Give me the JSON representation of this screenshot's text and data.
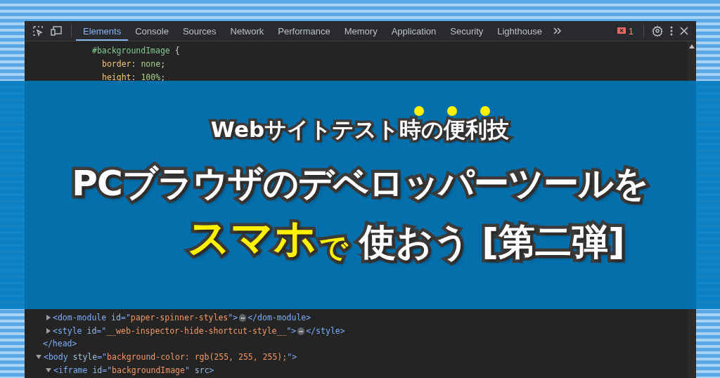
{
  "toolbar": {
    "tabs": [
      {
        "label": "Elements",
        "selected": true
      },
      {
        "label": "Console",
        "selected": false
      },
      {
        "label": "Sources",
        "selected": false
      },
      {
        "label": "Network",
        "selected": false
      },
      {
        "label": "Performance",
        "selected": false
      },
      {
        "label": "Memory",
        "selected": false
      },
      {
        "label": "Application",
        "selected": false
      },
      {
        "label": "Security",
        "selected": false
      },
      {
        "label": "Lighthouse",
        "selected": false
      }
    ],
    "error_count": "1"
  },
  "css_rule": {
    "selector": "#backgroundImage",
    "open": "{",
    "declarations": [
      {
        "prop": "border",
        "colon": ":",
        "value": "none",
        "end": ";"
      },
      {
        "prop": "height",
        "colon": ":",
        "value": "100%",
        "end": ";"
      }
    ]
  },
  "dom_tree": [
    {
      "children": [
        {
          "expanded": false,
          "tokens": [
            {
              "kind": "tag",
              "text": "<dom-module"
            },
            {
              "kind": "attr",
              "text": " id"
            },
            {
              "kind": "tag",
              "text": "=\""
            },
            {
              "kind": "value",
              "text": "paper-spinner-styles"
            },
            {
              "kind": "tag",
              "text": "\">"
            },
            {
              "kind": "ellipsis",
              "text": "⋯"
            },
            {
              "kind": "tag",
              "text": "</dom-module>"
            }
          ]
        },
        {
          "expanded": false,
          "tokens": [
            {
              "kind": "tag",
              "text": "<style"
            },
            {
              "kind": "attr",
              "text": " id"
            },
            {
              "kind": "tag",
              "text": "=\""
            },
            {
              "kind": "value",
              "text": "__web-inspector-hide-shortcut-style__"
            },
            {
              "kind": "tag",
              "text": "\">"
            },
            {
              "kind": "ellipsis",
              "text": "⋯"
            },
            {
              "kind": "tag",
              "text": "</style>"
            }
          ]
        }
      ]
    },
    {
      "tokens": [
        {
          "kind": "tag",
          "text": "</head>"
        }
      ]
    },
    {
      "expanded": true,
      "tokens": [
        {
          "kind": "tag",
          "text": "<body"
        },
        {
          "kind": "attr",
          "text": " style"
        },
        {
          "kind": "tag",
          "text": "=\""
        },
        {
          "kind": "value",
          "text": "background-color: rgb(255, 255, 255);"
        },
        {
          "kind": "tag",
          "text": "\">"
        }
      ],
      "children": [
        {
          "expanded": true,
          "tokens": [
            {
              "kind": "tag",
              "text": "<iframe"
            },
            {
              "kind": "attr",
              "text": " id"
            },
            {
              "kind": "tag",
              "text": "=\""
            },
            {
              "kind": "value",
              "text": "backgroundImage"
            },
            {
              "kind": "tag",
              "text": "\""
            },
            {
              "kind": "attr",
              "text": " src"
            },
            {
              "kind": "tag",
              "text": ">"
            }
          ]
        }
      ]
    }
  ],
  "banner": {
    "subtitle": "Webサイトテスト時の便利技",
    "title": "PCブラウザのデベロッパーツールを",
    "title_parts": [
      {
        "text": "スマホ",
        "highlight": true,
        "kind": "large"
      },
      {
        "text": "で",
        "highlight": true,
        "kind": "small"
      },
      {
        "text": "使おう",
        "highlight": false,
        "kind": "large"
      },
      {
        "text": "[第二弾]",
        "highlight": false,
        "kind": "large"
      }
    ]
  }
}
